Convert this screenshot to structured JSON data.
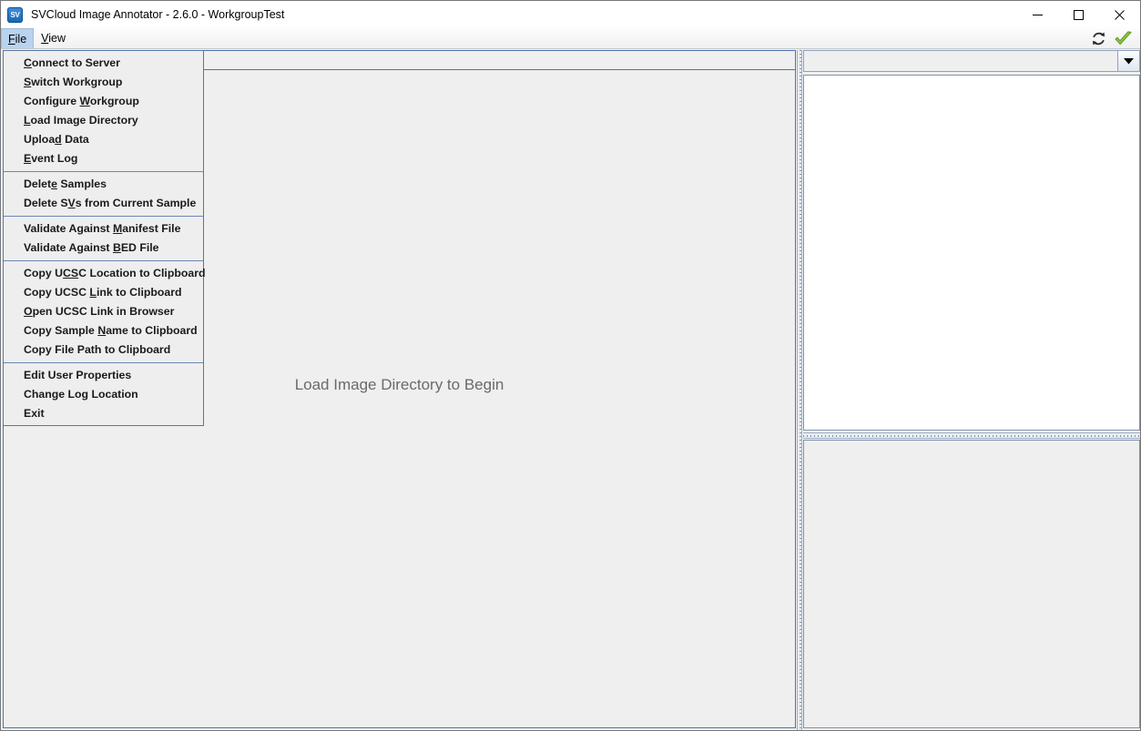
{
  "window": {
    "app_icon_label": "SV",
    "title": "SVCloud Image Annotator - 2.6.0 - WorkgroupTest",
    "controls": {
      "minimize": "minimize-icon",
      "maximize": "maximize-icon",
      "close": "close-icon"
    }
  },
  "menubar": {
    "items": [
      {
        "label": "File",
        "mnemonic": "F",
        "active": true
      },
      {
        "label": "View",
        "mnemonic": "V",
        "active": false
      }
    ]
  },
  "toolbar": {
    "icons": [
      {
        "name": "refresh-icon",
        "color": "#2b2b2b"
      },
      {
        "name": "checkmark-icon",
        "color": "#7ac943"
      }
    ]
  },
  "file_menu": {
    "groups": [
      {
        "items": [
          {
            "label": "Connect to Server",
            "mnemonic_index": 0
          },
          {
            "label": "Switch Workgroup",
            "mnemonic_index": 0
          },
          {
            "label": "Configure Workgroup",
            "mnemonic_index": 10
          },
          {
            "label": "Load Image Directory",
            "mnemonic_index": 0
          },
          {
            "label": "Upload Data",
            "mnemonic_index": 5
          },
          {
            "label": "Event Log",
            "mnemonic_index": 0
          }
        ]
      },
      {
        "items": [
          {
            "label": "Delete Samples",
            "mnemonic_index": 5
          },
          {
            "label": "Delete SVs from Current Sample",
            "mnemonic_index": 8
          }
        ]
      },
      {
        "items": [
          {
            "label": "Validate Against Manifest File",
            "mnemonic_index": 17
          },
          {
            "label": "Validate Against BED File",
            "mnemonic_index": 17
          }
        ]
      },
      {
        "items": [
          {
            "label": "Copy UCSC Location to Clipboard",
            "mnemonic_index": 6
          },
          {
            "label": "Copy UCSC Link to Clipboard",
            "mnemonic_index": 10
          },
          {
            "label": "Open UCSC Link in Browser",
            "mnemonic_index": 0
          },
          {
            "label": "Copy Sample Name to Clipboard",
            "mnemonic_index": 12
          },
          {
            "label": "Copy File Path to Clipboard",
            "mnemonic_index": -1
          }
        ]
      },
      {
        "items": [
          {
            "label": "Edit User Properties",
            "mnemonic_index": -1
          },
          {
            "label": "Change Log Location",
            "mnemonic_index": -1
          },
          {
            "label": "Exit",
            "mnemonic_index": -1
          }
        ]
      }
    ]
  },
  "main_panel": {
    "message": "Load Image Directory to Begin"
  },
  "right_panel": {
    "sample_combo": {
      "value": "",
      "placeholder": ""
    },
    "list_items": [],
    "details_text": ""
  },
  "colors": {
    "accent_blue": "#4a74b0",
    "menu_border": "#5577aa",
    "selected_menu": "#b9d3ef",
    "panel_bg": "#efefef",
    "divider": "#7e93ad",
    "check_green": "#7ac943"
  }
}
